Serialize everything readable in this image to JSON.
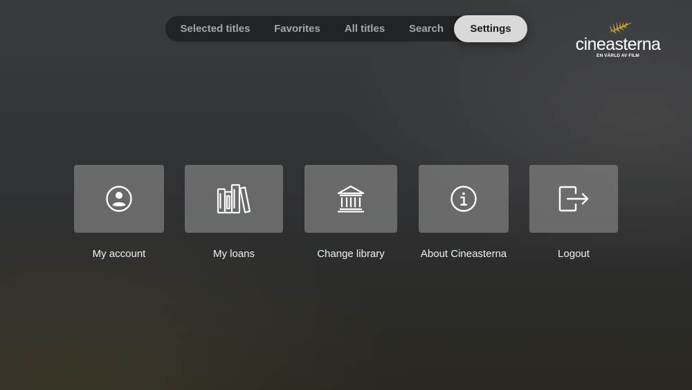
{
  "nav": {
    "tabs": [
      {
        "label": "Selected titles"
      },
      {
        "label": "Favorites"
      },
      {
        "label": "All titles"
      },
      {
        "label": "Search"
      },
      {
        "label": "Settings",
        "active": true
      }
    ]
  },
  "logo": {
    "wordmark": "cineasterna",
    "tagline": "EN VÄRLD AV FILM",
    "icon": "palm-leaf-icon",
    "accent_color": "#c9a227"
  },
  "settings": {
    "items": [
      {
        "label": "My account",
        "icon": "user-circle-icon"
      },
      {
        "label": "My loans",
        "icon": "books-icon"
      },
      {
        "label": "Change library",
        "icon": "library-building-icon"
      },
      {
        "label": "About Cineasterna",
        "icon": "info-icon"
      },
      {
        "label": "Logout",
        "icon": "logout-icon"
      }
    ]
  },
  "colors": {
    "active_tab_bg": "#d9d9d9",
    "nav_bg": "#212325",
    "tile_bg": "#808080"
  }
}
